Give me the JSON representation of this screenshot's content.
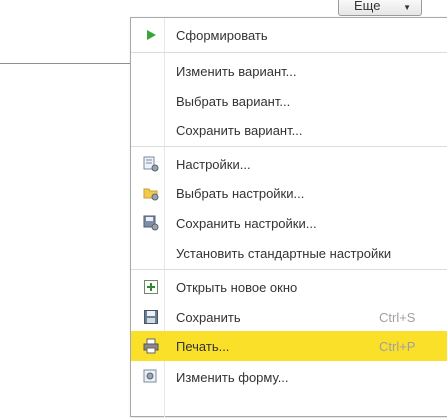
{
  "more_button": {
    "label": "Еще"
  },
  "menu": {
    "items": [
      {
        "label": "Сформировать",
        "icon": "play-icon"
      },
      {
        "label": "Изменить вариант..."
      },
      {
        "label": "Выбрать вариант..."
      },
      {
        "label": "Сохранить вариант..."
      },
      {
        "label": "Настройки...",
        "icon": "settings-list-icon"
      },
      {
        "label": "Выбрать настройки...",
        "icon": "folder-settings-icon"
      },
      {
        "label": "Сохранить настройки...",
        "icon": "save-settings-icon"
      },
      {
        "label": "Установить стандартные настройки"
      },
      {
        "label": "Открыть новое окно",
        "icon": "new-window-icon"
      },
      {
        "label": "Сохранить",
        "icon": "save-icon",
        "shortcut": "Ctrl+S"
      },
      {
        "label": "Печать...",
        "icon": "print-icon",
        "shortcut": "Ctrl+P",
        "highlighted": true
      },
      {
        "label": "Изменить форму...",
        "icon": "edit-form-icon"
      }
    ]
  },
  "colors": {
    "highlight": "#fbe02a",
    "play_green": "#3aa63a",
    "shortcut_gray": "#a0a0a0"
  }
}
